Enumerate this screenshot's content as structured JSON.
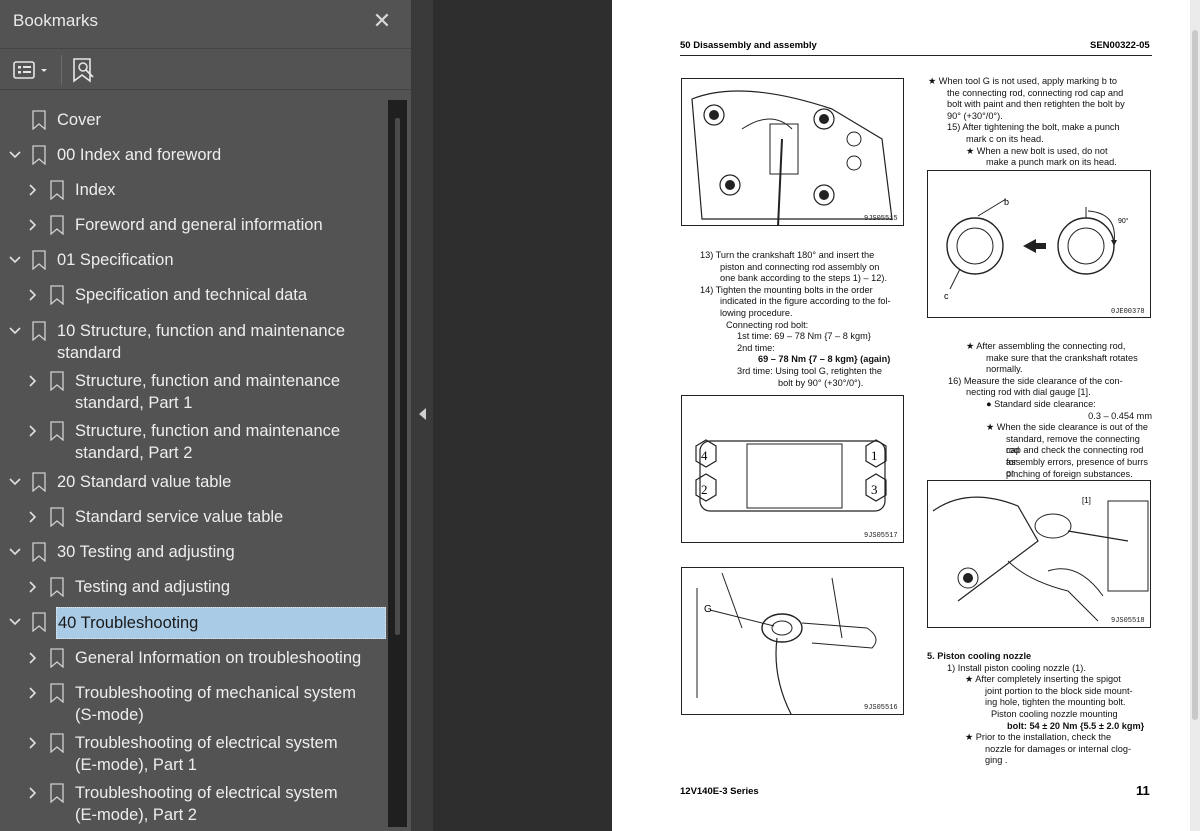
{
  "panel": {
    "title": "Bookmarks",
    "close_symbol": "✕"
  },
  "tree": [
    {
      "label": "Cover",
      "level": 0,
      "expander": "none"
    },
    {
      "label": "00 Index and foreword",
      "level": 0,
      "expander": "expanded"
    },
    {
      "label": "Index",
      "level": 1,
      "expander": "collapsed"
    },
    {
      "label": "Foreword and general information",
      "level": 1,
      "expander": "collapsed"
    },
    {
      "label": "01 Specification",
      "level": 0,
      "expander": "expanded"
    },
    {
      "label": "Specification and technical data",
      "level": 1,
      "expander": "collapsed"
    },
    {
      "label": "10 Structure, function and maintenance",
      "label2": "standard",
      "level": 0,
      "expander": "expanded"
    },
    {
      "label": "Structure, function and maintenance",
      "label2": "standard, Part 1",
      "level": 1,
      "expander": "collapsed"
    },
    {
      "label": "Structure, function and maintenance",
      "label2": "standard, Part 2",
      "level": 1,
      "expander": "collapsed"
    },
    {
      "label": "20 Standard value table",
      "level": 0,
      "expander": "expanded"
    },
    {
      "label": "Standard service value table",
      "level": 1,
      "expander": "collapsed"
    },
    {
      "label": "30 Testing and adjusting",
      "level": 0,
      "expander": "expanded"
    },
    {
      "label": "Testing and adjusting",
      "level": 1,
      "expander": "collapsed"
    },
    {
      "label": "40 Troubleshooting",
      "level": 0,
      "expander": "expanded",
      "selected": true
    },
    {
      "label": "General Information on troubleshooting",
      "level": 1,
      "expander": "collapsed"
    },
    {
      "label": "Troubleshooting of mechanical system",
      "label2": "(S-mode)",
      "level": 1,
      "expander": "collapsed"
    },
    {
      "label": "Troubleshooting of electrical system",
      "label2": "(E-mode), Part 1",
      "level": 1,
      "expander": "collapsed"
    },
    {
      "label": "Troubleshooting of electrical system",
      "label2": "(E-mode), Part 2",
      "level": 1,
      "expander": "collapsed"
    }
  ],
  "document": {
    "header_left": "50 Disassembly and assembly",
    "header_right": "SEN00322-05",
    "footer_left": "12V140E-3 Series",
    "page_number": "11",
    "fig_codes": [
      "9JS05515",
      "9JS05517",
      "9JS05516",
      "0JE00378",
      "9JS05518"
    ],
    "fig_labels": {
      "b": "b",
      "c": "c",
      "angle": "90°",
      "G": "G",
      "bracket1": "[1]",
      "n1": "1",
      "n2": "2",
      "n3": "3",
      "n4": "4"
    },
    "left_col": [
      "13) Turn the crankshaft 180° and insert the",
      "piston and connecting rod assembly on",
      "one bank according to the steps 1) – 12).",
      "14) Tighten the mounting bolts in the order",
      "indicated in the figure according to the fol-",
      "lowing procedure.",
      "Connecting rod bolt:",
      "1st time: 69 – 78 Nm {7 – 8 kgm}",
      "2nd time:",
      "69 – 78 Nm {7 – 8 kgm} (again)",
      "3rd time: Using tool G, retighten the",
      "bolt by 90° (+30°/0°)."
    ],
    "right_col_top": [
      "★  When tool G is not used, apply marking b to",
      "the connecting rod, connecting rod cap and",
      "bolt with paint and then retighten the bolt by",
      "90° (+30°/0°).",
      "15) After tightening the bolt, make a punch",
      "mark c on its head.",
      "★  When a new bolt is used, do not",
      "make a punch mark on its head."
    ],
    "right_col_mid": [
      "★  After assembling the connecting rod,",
      "make sure that the crankshaft rotates",
      "normally.",
      "16) Measure the side clearance of the con-",
      "necting rod with dial gauge [1].",
      "●  Standard side clearance:",
      "0.3 – 0.454 mm",
      "★  When the side clearance is out of the",
      "standard, remove the connecting rod",
      "cap and check the connecting rod for",
      "assembly errors, presence of burrs or",
      "pinching of foreign substances."
    ],
    "right_col_bottom": [
      "5.  Piston cooling nozzle",
      "1)  Install piston cooling nozzle (1).",
      "★  After completely inserting the spigot",
      "joint portion to the block side mount-",
      "ing hole, tighten the mounting bolt.",
      "Piston cooling nozzle mounting",
      "bolt: 54 ± 20 Nm {5.5 ± 2.0 kgm}",
      "★  Prior to the installation, check the",
      "nozzle for damages or internal clog-",
      "ging ."
    ]
  }
}
